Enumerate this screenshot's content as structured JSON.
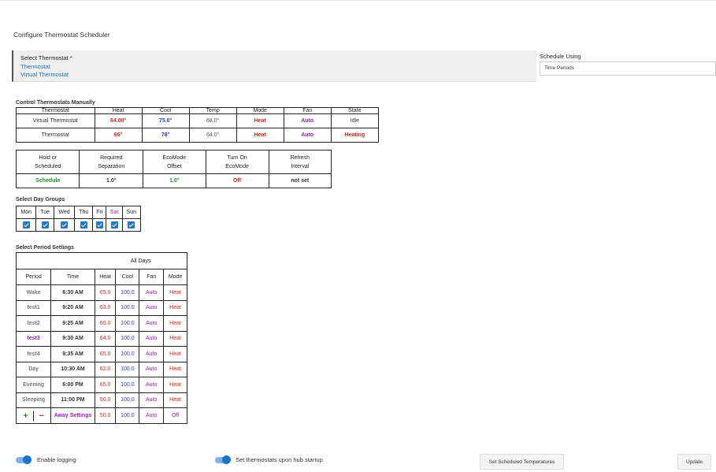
{
  "page_title": "Configure Thermostat Scheduler",
  "select_thermostat": {
    "label": "Select Thermostat *",
    "items": [
      "Thermostat",
      "Virtual Thermostat"
    ]
  },
  "schedule_using": {
    "label": "Schedule Using",
    "value": "Time Periods"
  },
  "control": {
    "title": "Control Thermostats Manually",
    "headers": [
      "Thermostat",
      "Heat",
      "Cool",
      "Temp",
      "Mode",
      "Fan",
      "State"
    ],
    "rows": [
      {
        "name": "Virtual Thermostat",
        "heat": "64.00°",
        "cool": "75.0°",
        "temp": "68.0°",
        "mode": "Heat",
        "fan": "Auto",
        "state": "Idle"
      },
      {
        "name": "Thermostat",
        "heat": "66°",
        "cool": "78°",
        "temp": "64.0°",
        "mode": "Heat",
        "fan": "Auto",
        "state": "Heating"
      }
    ],
    "options_headers": [
      "Hold or Scheduled",
      "Required Separation",
      "EcoMode Offset",
      "Turn On EcoMode",
      "Refresh Interval"
    ],
    "options_values": [
      "Schedule",
      "1.0°",
      "1.0°",
      "Off",
      "not set"
    ]
  },
  "day_groups": {
    "title": "Select Day Groups",
    "days": [
      "Mon",
      "Tue",
      "Wed",
      "Thu",
      "Fri",
      "Sat",
      "Sun"
    ],
    "checked": [
      true,
      true,
      true,
      true,
      true,
      true,
      true
    ]
  },
  "periods": {
    "title": "Select Period Settings",
    "group_header": "All Days",
    "headers": [
      "Period",
      "Time",
      "Heat",
      "Cool",
      "Fan",
      "Mode"
    ],
    "rows": [
      {
        "period": "Wake",
        "time": "6:30 AM",
        "heat": "65.0",
        "cool": "100.0",
        "fan": "Auto",
        "mode": "Heat"
      },
      {
        "period": "test1",
        "time": "9:20 AM",
        "heat": "63.0",
        "cool": "100.0",
        "fan": "Auto",
        "mode": "Heat"
      },
      {
        "period": "test2",
        "time": "9:25 AM",
        "heat": "66.0",
        "cool": "100.0",
        "fan": "Auto",
        "mode": "Heat"
      },
      {
        "period": "test3",
        "time": "9:30 AM",
        "heat": "64.0",
        "cool": "100.0",
        "fan": "Auto",
        "mode": "Heat"
      },
      {
        "period": "test4",
        "time": "9:35 AM",
        "heat": "65.0",
        "cool": "100.0",
        "fan": "Auto",
        "mode": "Heat"
      },
      {
        "period": "Day",
        "time": "10:30 AM",
        "heat": "62.0",
        "cool": "100.0",
        "fan": "Auto",
        "mode": "Heat"
      },
      {
        "period": "Evening",
        "time": "6:00 PM",
        "heat": "65.0",
        "cool": "100.0",
        "fan": "Auto",
        "mode": "Heat"
      },
      {
        "period": "Sleeping",
        "time": "11:00 PM",
        "heat": "50.0",
        "cool": "100.0",
        "fan": "Auto",
        "mode": "Heat"
      }
    ],
    "away": {
      "plus": "+",
      "minus": "−",
      "label": "Away Settings",
      "heat": "50.0",
      "cool": "100.0",
      "fan": "Auto",
      "mode": "Off"
    }
  },
  "footer": {
    "enable_logging": "Enable logging",
    "set_on_startup": "Set thermostats upon hub startup",
    "set_scheduled_button": "Set Scheduled Temperatures",
    "update_button": "Update"
  }
}
